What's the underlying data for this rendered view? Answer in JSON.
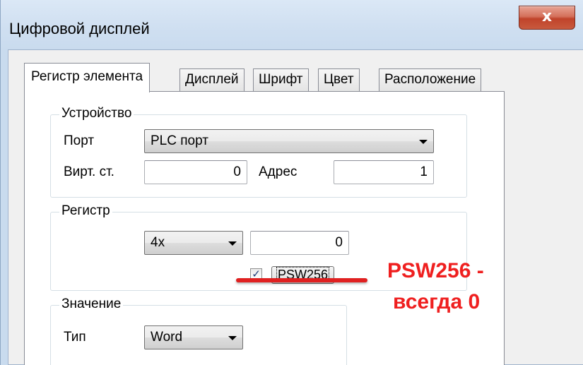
{
  "window": {
    "title": "Цифровой дисплей",
    "close_glyph": "x"
  },
  "tabs": [
    {
      "label": "Регистр элемента",
      "active": true
    },
    {
      "label": "Дисплей",
      "active": false
    },
    {
      "label": "Шрифт",
      "active": false
    },
    {
      "label": "Цвет",
      "active": false
    },
    {
      "label": "Расположение",
      "active": false
    }
  ],
  "device_group": {
    "title": "Устройство",
    "port_label": "Порт",
    "port_value": "PLC порт",
    "virt_label": "Вирт. ст.",
    "virt_value": "0",
    "address_label": "Адрес",
    "address_value": "1"
  },
  "register_group": {
    "title": "Регистр",
    "type_value": "4x",
    "address_value": "0",
    "psw_checked": true,
    "psw_checkmark": "✓",
    "psw_label": "PSW256"
  },
  "value_group": {
    "title": "Значение",
    "type_label": "Тип",
    "type_value": "Word"
  },
  "annotation": {
    "line1": "PSW256 -",
    "line2": "всегда 0",
    "color": "#ef1f1f"
  }
}
